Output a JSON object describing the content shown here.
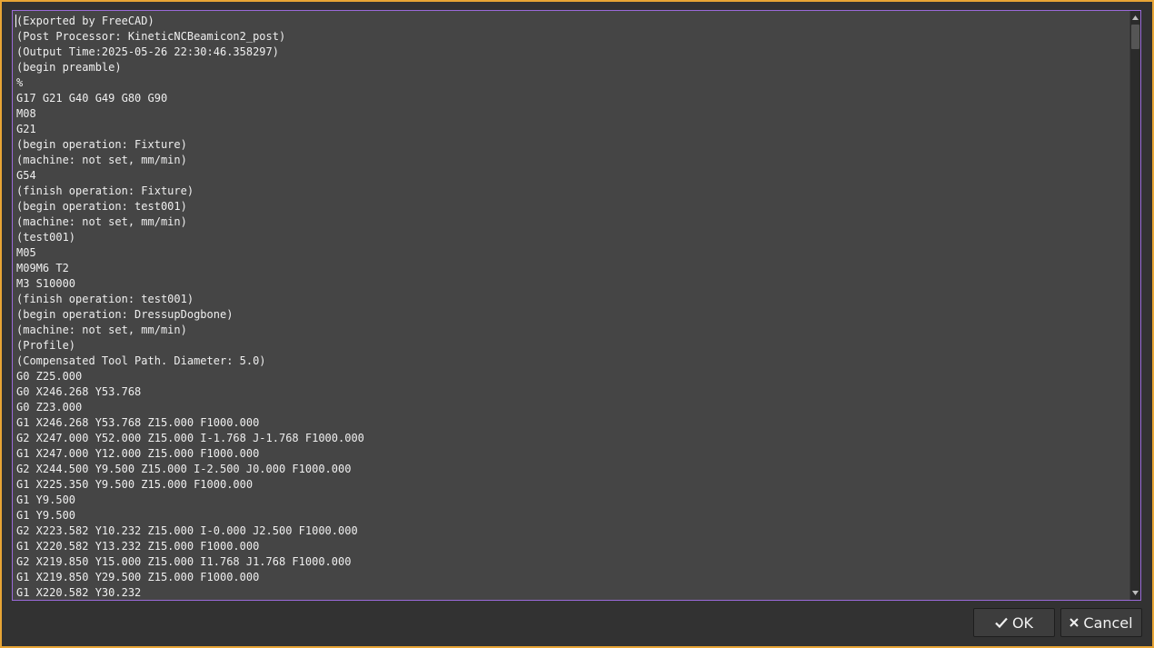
{
  "editor": {
    "lines": [
      "(Exported by FreeCAD)",
      "(Post Processor: KineticNCBeamicon2_post)",
      "(Output Time:2025-05-26 22:30:46.358297)",
      "(begin preamble)",
      "%",
      "G17 G21 G40 G49 G80 G90",
      "M08",
      "G21",
      "(begin operation: Fixture)",
      "(machine: not set, mm/min)",
      "G54",
      "(finish operation: Fixture)",
      "(begin operation: test001)",
      "(machine: not set, mm/min)",
      "(test001)",
      "M05",
      "M09M6 T2",
      "M3 S10000",
      "(finish operation: test001)",
      "(begin operation: DressupDogbone)",
      "(machine: not set, mm/min)",
      "(Profile)",
      "(Compensated Tool Path. Diameter: 5.0)",
      "G0 Z25.000",
      "G0 X246.268 Y53.768",
      "G0 Z23.000",
      "G1 X246.268 Y53.768 Z15.000 F1000.000",
      "G2 X247.000 Y52.000 Z15.000 I-1.768 J-1.768 F1000.000",
      "G1 X247.000 Y12.000 Z15.000 F1000.000",
      "G2 X244.500 Y9.500 Z15.000 I-2.500 J0.000 F1000.000",
      "G1 X225.350 Y9.500 Z15.000 F1000.000",
      "G1 Y9.500",
      "G1 Y9.500",
      "G2 X223.582 Y10.232 Z15.000 I-0.000 J2.500 F1000.000",
      "G1 X220.582 Y13.232 Z15.000 F1000.000",
      "G2 X219.850 Y15.000 Z15.000 I1.768 J1.768 F1000.000",
      "G1 X219.850 Y29.500 Z15.000 F1000.000",
      "G1 X220.582 Y30.232"
    ]
  },
  "buttons": {
    "ok_label": "OK",
    "cancel_label": "Cancel"
  },
  "icons": {
    "ok": "check-icon",
    "cancel": "close-icon",
    "scroll_up": "triangle-up-icon",
    "scroll_down": "triangle-down-icon"
  },
  "colors": {
    "window_border": "#e8a535",
    "dialog_bg": "#323232",
    "editor_bg": "#454545",
    "editor_focus_border": "#9a6ad8",
    "text": "#efefef"
  }
}
